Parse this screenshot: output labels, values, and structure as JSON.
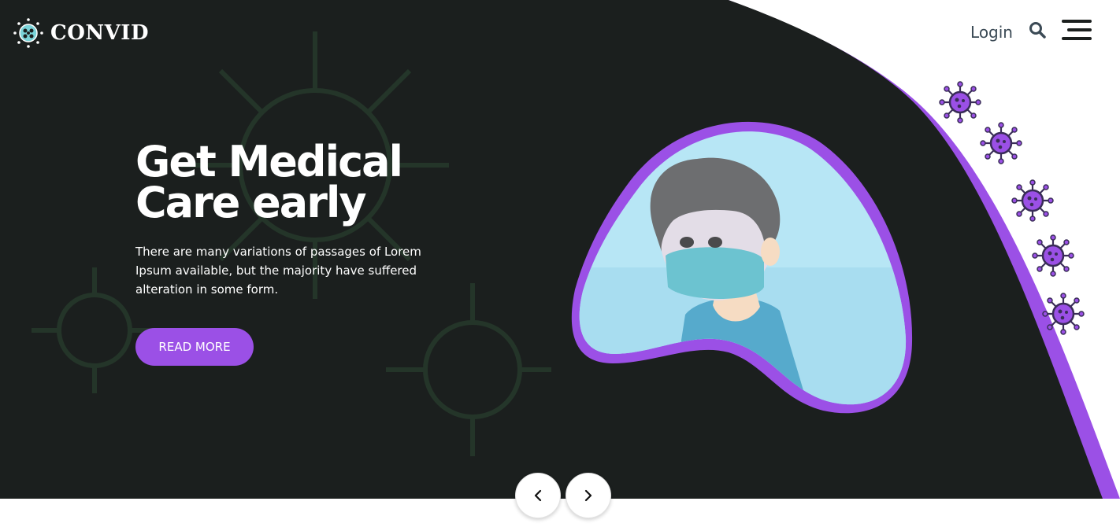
{
  "brand": {
    "name": "CONVID",
    "logo_icon": "virus-logo-icon"
  },
  "nav": {
    "login_label": "Login",
    "search_icon": "search-icon",
    "menu_icon": "hamburger-menu-icon"
  },
  "hero": {
    "title": "Get Medical Care early",
    "description": "There are many variations of passages of Lorem Ipsum available, but the majority have suffered alteration in some form.",
    "button_label": "READ MORE"
  },
  "slider": {
    "prev_icon": "chevron-left-icon",
    "next_icon": "chevron-right-icon"
  },
  "colors": {
    "accent": "#9b50e6",
    "hero_bg": "#1b1f1e",
    "nav_text": "#3b4a55",
    "white": "#ffffff"
  }
}
